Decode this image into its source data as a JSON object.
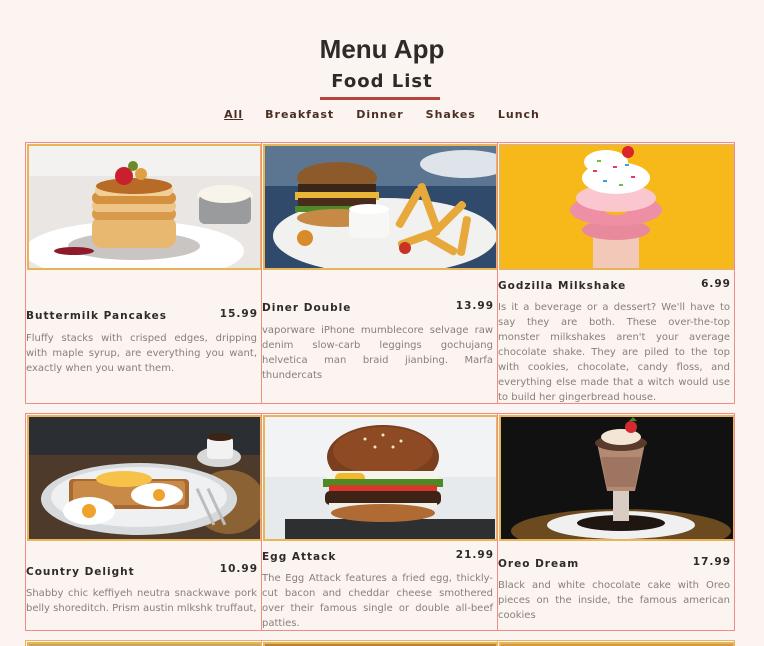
{
  "header": {
    "title": "Menu App",
    "subtitle": "Food List"
  },
  "filters": [
    "All",
    "Breakfast",
    "Dinner",
    "Shakes",
    "Lunch"
  ],
  "active_filter": "All",
  "items": [
    {
      "name": "Buttermilk Pancakes",
      "price": "15.99",
      "image": "pancakes-photo",
      "desc": "Fluffy stacks with crisped edges, dripping with maple syrup, are everything you want, exactly when you want them."
    },
    {
      "name": "Diner Double",
      "price": "13.99",
      "image": "burger-fries-photo",
      "desc": "vaporware iPhone mumblecore selvage raw denim slow-carb leggings gochujang helvetica man braid jianbing. Marfa thundercats"
    },
    {
      "name": "Godzilla Milkshake",
      "price": "6.99",
      "image": "donut-milkshake-photo",
      "desc": "Is it a beverage or a dessert? We'll have to say they are both. These over-the-top monster milkshakes aren't your average chocolate shake. They are piled to the top with cookies, chocolate, candy floss, and everything else made that a witch would use to build her gingerbread house."
    },
    {
      "name": "Country Delight",
      "price": "10.99",
      "image": "eggs-toast-photo",
      "desc": "Shabby chic keffiyeh neutra snackwave pork belly shoreditch. Prism austin mlkshk truffaut,"
    },
    {
      "name": "Egg Attack",
      "price": "21.99",
      "image": "egg-burger-photo",
      "desc": "The Egg Attack features a fried egg, thickly-cut bacon and cheddar cheese smothered over their famous single or double all-beef patties."
    },
    {
      "name": "Oreo Dream",
      "price": "17.99",
      "image": "oreo-shake-photo",
      "desc": "Black and white chocolate cake with Oreo pieces on the inside, the famous american cookies"
    }
  ]
}
